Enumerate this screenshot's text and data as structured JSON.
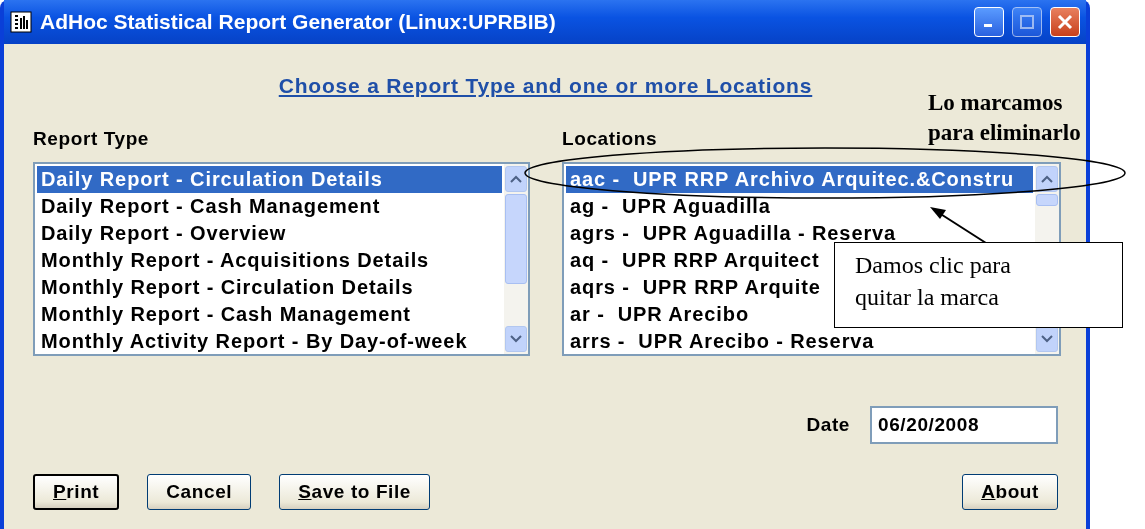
{
  "window": {
    "title": "AdHoc Statistical Report Generator (Linux:UPRBIB)"
  },
  "instruction_link": "Choose a Report Type and one or more Locations",
  "report_type": {
    "label": "Report Type",
    "items": [
      {
        "text": "Daily Report - Circulation Details",
        "selected": true
      },
      {
        "text": "Daily Report - Cash Management",
        "selected": false
      },
      {
        "text": "Daily Report - Overview",
        "selected": false
      },
      {
        "text": "Monthly Report - Acquisitions Details",
        "selected": false
      },
      {
        "text": "Monthly Report - Circulation Details",
        "selected": false
      },
      {
        "text": "Monthly Report - Cash Management",
        "selected": false
      },
      {
        "text": "Monthly Activity Report - By Day-of-week",
        "selected": false
      }
    ]
  },
  "locations": {
    "label": "Locations",
    "items": [
      {
        "text": "aac -  UPR RRP Archivo Arquitec.&Constru",
        "selected": true
      },
      {
        "text": "ag -  UPR Aguadilla",
        "selected": false
      },
      {
        "text": "agrs -  UPR Aguadilla - Reserva",
        "selected": false
      },
      {
        "text": "aq -  UPR RRP Arquitect",
        "selected": false
      },
      {
        "text": "aqrs -  UPR RRP Arquite",
        "selected": false
      },
      {
        "text": "ar -  UPR Arecibo",
        "selected": false
      },
      {
        "text": "arrs -  UPR Arecibo - Reserva",
        "selected": false
      }
    ]
  },
  "date": {
    "label": "Date",
    "value": "06/20/2008"
  },
  "buttons": [
    {
      "label": "Print",
      "mnemonic": true,
      "default": true
    },
    {
      "label": "Cancel",
      "mnemonic": false,
      "default": false
    },
    {
      "label": "Save to File",
      "mnemonic": true,
      "default": false
    },
    {
      "label": "About",
      "mnemonic": true,
      "default": false
    }
  ],
  "annotations": {
    "note": [
      "Lo marcamos",
      "para eliminarlo"
    ],
    "callout": [
      "Damos clic para",
      "quitar la marca"
    ]
  }
}
